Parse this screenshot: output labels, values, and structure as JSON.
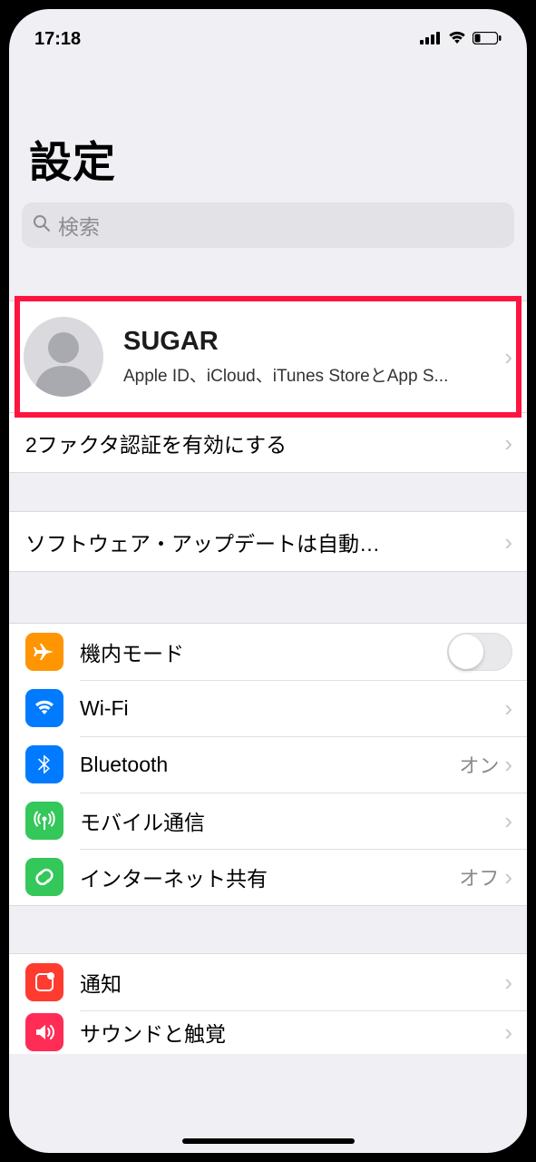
{
  "status": {
    "time": "17:18"
  },
  "title": "設定",
  "search": {
    "placeholder": "検索"
  },
  "apple_id": {
    "name": "SUGAR",
    "subtitle": "Apple ID、iCloud、iTunes StoreとApp S..."
  },
  "two_factor": {
    "label": "2ファクタ認証を有効にする"
  },
  "software_update": {
    "label": "ソフトウェア・アップデートは自動…"
  },
  "rows": {
    "airplane": {
      "label": "機内モード"
    },
    "wifi": {
      "label": "Wi-Fi",
      "value": ""
    },
    "bluetooth": {
      "label": "Bluetooth",
      "value": "オン"
    },
    "cellular": {
      "label": "モバイル通信"
    },
    "hotspot": {
      "label": "インターネット共有",
      "value": "オフ"
    },
    "notifications": {
      "label": "通知"
    },
    "sounds": {
      "label": "サウンドと触覚"
    }
  }
}
